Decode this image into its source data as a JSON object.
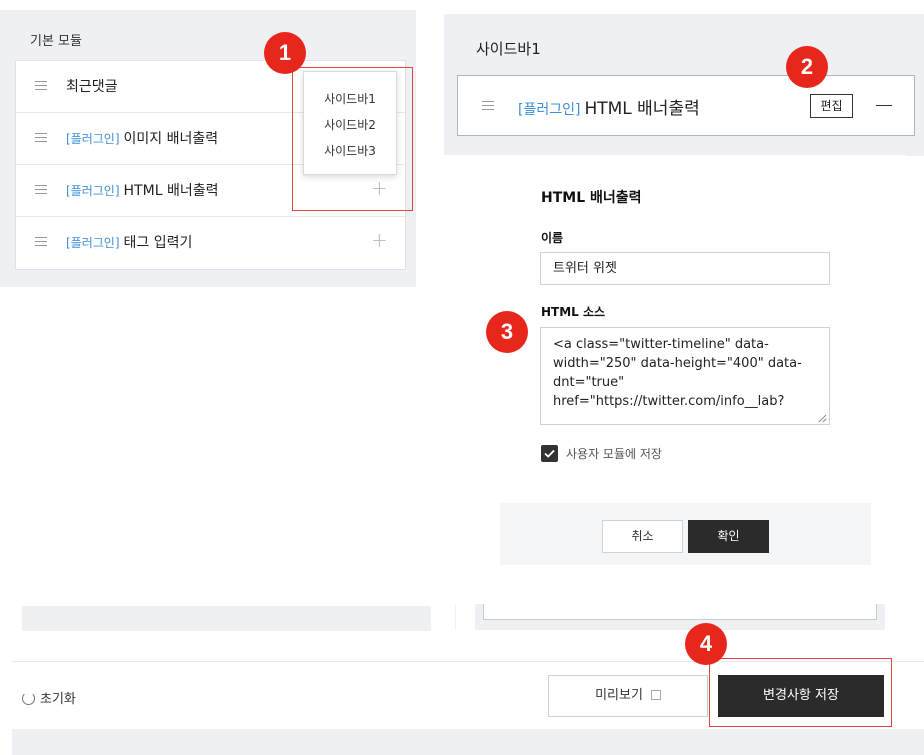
{
  "left_panel": {
    "title": "기본 모듈",
    "modules": [
      {
        "tag": "",
        "name": "최근댓글"
      },
      {
        "tag": "[플러그인]",
        "name": "이미지 배너출력"
      },
      {
        "tag": "[플러그인]",
        "name": "HTML 배너출력"
      },
      {
        "tag": "[플러그인]",
        "name": "태그 입력기"
      }
    ],
    "add_symbol": "+",
    "dropdown_items": [
      "사이드바1",
      "사이드바2",
      "사이드바3"
    ]
  },
  "right_panel": {
    "title": "사이드바1",
    "card": {
      "tag": "[플러그인]",
      "name": "HTML 배너출력",
      "edit_label": "편집"
    }
  },
  "dialog": {
    "title": "HTML 배너출력",
    "name_label": "이름",
    "name_value": "트위터 위젯",
    "source_label": "HTML 소스",
    "source_value": "<a class=\"twitter-timeline\" data-width=\"250\" data-height=\"400\" data-dnt=\"true\" href=\"https://twitter.com/info__lab?",
    "save_module_label": "사용자 모듈에 저장",
    "save_module_checked": true,
    "cancel_label": "취소",
    "confirm_label": "확인"
  },
  "bottom_bar": {
    "reset_label": "초기화",
    "preview_label": "미리보기",
    "save_changes_label": "변경사항 저장"
  },
  "badges": [
    "1",
    "2",
    "3",
    "4"
  ],
  "colors": {
    "accent_tag": "#3d8fd6",
    "badge": "#e8271c",
    "highlight_box": "#e04545",
    "dark_button": "#2b2b2b"
  }
}
